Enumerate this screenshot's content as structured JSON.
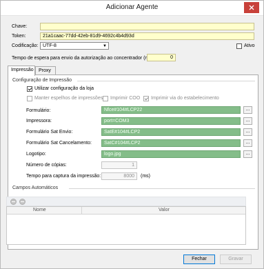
{
  "window": {
    "title": "Adicionar Agente"
  },
  "fields": {
    "chave_label": "Chave:",
    "chave_value": "",
    "token_label": "Token:",
    "token_value": "21a1caac-77dd-42eb-81d9-4692c4b4d93d",
    "codificacao_label": "Codificação:",
    "codificacao_value": "UTF-8",
    "ativo_label": "Ativo",
    "tempo_label": "Tempo de espera para envio da autorização ao concentrador (ms):",
    "tempo_value": "0"
  },
  "tabs": [
    {
      "label": "Impressão"
    },
    {
      "label": "Proxy"
    }
  ],
  "impressao": {
    "group_title": "Configuração de Impressão",
    "usar_config_loja": "Utilizar configuração da loja",
    "manter_espelhos": "Manter espelhos de impressões",
    "imprimir_coo": "Imprimir COO",
    "imprimir_via": "Imprimir via do estabelecimento",
    "rows": [
      {
        "label": "Formulário:",
        "value": "Nfce#104#LCP22"
      },
      {
        "label": "Impressora:",
        "value": "port=COM3"
      },
      {
        "label": "Formulário Sat Envio:",
        "value": "SatE#104#LCP2"
      },
      {
        "label": "Formulário Sat Cancelamento:",
        "value": "SatC#104#LCP2"
      },
      {
        "label": "Logotipo:",
        "value": "logo.jpg"
      }
    ],
    "copias_label": "Número de cópias:",
    "copias_value": "1",
    "tempo_captura_label": "Tempo para captura da impressão:",
    "tempo_captura_value": "8000",
    "tempo_captura_unit": "(ms)",
    "browse_label": "..."
  },
  "campos": {
    "group_title": "Campos Automáticos",
    "columns": [
      "Nome",
      "Valor"
    ]
  },
  "buttons": {
    "fechar": "Fechar",
    "gravar": "Gravar"
  }
}
